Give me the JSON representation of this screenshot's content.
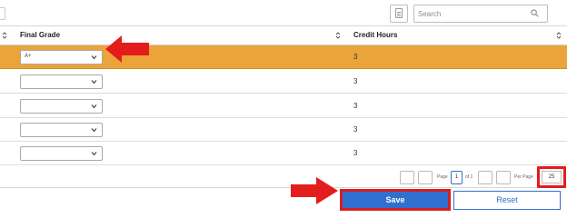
{
  "toolbar": {
    "search_placeholder": "Search",
    "column_toggle_icon": "document-list-icon",
    "search_icon": "search-icon"
  },
  "table": {
    "columns": [
      "Final Grade",
      "Credit Hours"
    ],
    "rows": [
      {
        "final_grade": "A+",
        "credit_hours": "3",
        "selected": true
      },
      {
        "final_grade": "",
        "credit_hours": "3",
        "selected": false
      },
      {
        "final_grade": "",
        "credit_hours": "3",
        "selected": false
      },
      {
        "final_grade": "",
        "credit_hours": "3",
        "selected": false
      },
      {
        "final_grade": "",
        "credit_hours": "3",
        "selected": false
      }
    ]
  },
  "pagination": {
    "page_label": "Page",
    "page_number": "1",
    "of_label": "of 1",
    "per_page_label": "Per Page",
    "per_page_value": "25"
  },
  "actions": {
    "save_label": "Save",
    "reset_label": "Reset"
  },
  "colors": {
    "selected_row": "#eaa43a",
    "primary": "#2f6fce",
    "annotation_red": "#e31c1c"
  }
}
